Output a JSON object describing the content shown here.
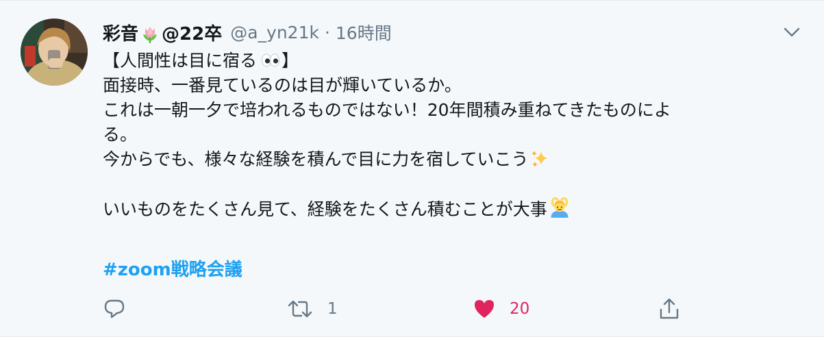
{
  "tweet": {
    "display_name_pre": "彩音",
    "display_name_post": "@22卒",
    "name_emoji": "tulip-icon",
    "handle": "@a_yn21k",
    "separator": "·",
    "time": "16時間",
    "lines": [
      "【人間性は目に宿る",
      "面接時、一番見ているのは目が輝いているか。",
      "これは一朝一夕で培われるものではない！20年間積み重ねてきたものによ",
      "る。",
      "今からでも、様々な経験を積んで目に力を宿していこう",
      "",
      "いいものをたくさん見て、経験をたくさん積むことが大事"
    ],
    "line1_suffix": "】",
    "emojis": {
      "line1": "eyes-icon",
      "line5": "sparkles-icon",
      "line7": "person-gesturing-ok-icon"
    },
    "hashtag": "#zoom戦略会議"
  },
  "actions": {
    "reply_count": "",
    "retweet_count": "1",
    "like_count": "20",
    "share_count": ""
  },
  "colors": {
    "background": "#f5f8fa",
    "text": "#14171a",
    "secondary": "#657786",
    "link": "#1da1f2",
    "like": "#e0245e"
  }
}
